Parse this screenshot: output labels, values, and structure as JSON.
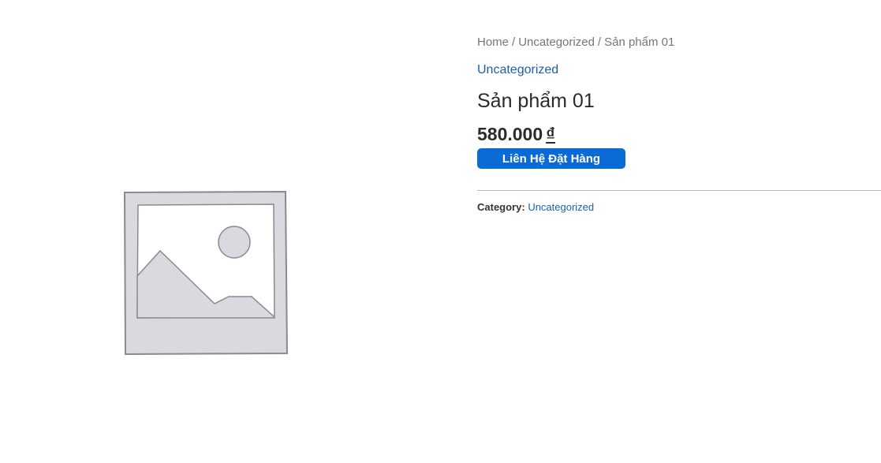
{
  "product_gallery": {
    "image_icon": "image-placeholder-icon"
  },
  "breadcrumb": {
    "items": [
      "Home",
      "Uncategorized",
      "Sản phẩm 01"
    ],
    "separator": "/"
  },
  "product": {
    "category_link": "Uncategorized",
    "title": "Sản phẩm 01",
    "price_amount": "580.000",
    "price_currency": "₫",
    "order_button_label": "Liên Hệ Đặt Hàng"
  },
  "meta": {
    "category_label": "Category:",
    "category_value": "Uncategorized"
  },
  "colors": {
    "accent_button": "#0a6ad6",
    "link": "#1e5fa8",
    "breadcrumb_text": "#767676",
    "placeholder_fill": "#d9dadf",
    "placeholder_stroke": "#8a8a8e"
  }
}
